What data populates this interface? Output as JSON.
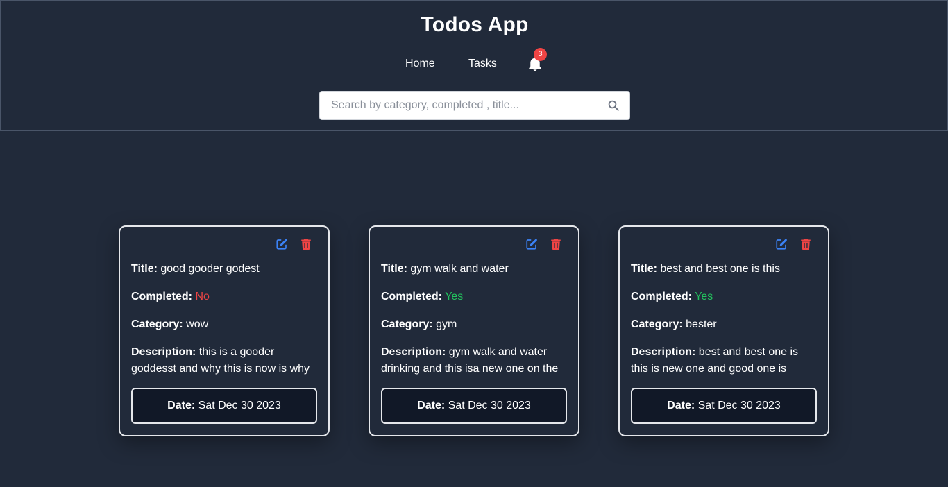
{
  "header": {
    "title": "Todos App",
    "nav": {
      "home": "Home",
      "tasks": "Tasks"
    },
    "notifications": {
      "count": "3"
    },
    "search": {
      "placeholder": "Search by category, completed , title..."
    }
  },
  "labels": {
    "title": "Title:",
    "completed": "Completed:",
    "category": "Category:",
    "description": "Description:",
    "date": "Date:"
  },
  "cards": [
    {
      "title": "good gooder godest",
      "completed": "No",
      "category": "wow",
      "description": "this is a gooder goddesst and why this is now is why",
      "date": "Sat Dec 30 2023"
    },
    {
      "title": "gym walk and water",
      "completed": "Yes",
      "category": "gym",
      "description": "gym walk and water drinking and this isa new one on the",
      "date": "Sat Dec 30 2023"
    },
    {
      "title": "best and best one is this",
      "completed": "Yes",
      "category": "bester",
      "description": "best and best one is this is new one and good one is",
      "date": "Sat Dec 30 2023"
    }
  ],
  "colors": {
    "background": "#212a3a",
    "edit": "#3b82f6",
    "delete": "#ef4444",
    "completed_yes": "#22c55e",
    "completed_no": "#ef4444"
  },
  "icons": {
    "notification": "bell-icon",
    "search": "search-icon",
    "edit": "edit-icon",
    "delete": "trash-icon"
  }
}
